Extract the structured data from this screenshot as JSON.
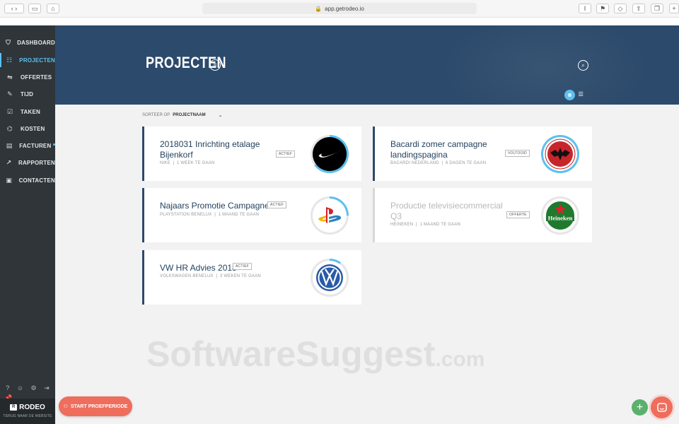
{
  "browser": {
    "url": "app.getrodeo.io",
    "buttons": [
      "‹",
      "›",
      "▭",
      "⌂"
    ]
  },
  "sidebar": {
    "items": [
      {
        "label": "DASHBOARD",
        "icon": "dashboard-icon"
      },
      {
        "label": "PROJECTEN",
        "icon": "projects-icon",
        "active": true
      },
      {
        "label": "OFFERTES",
        "icon": "quotes-icon"
      },
      {
        "label": "TIJD",
        "icon": "time-icon"
      },
      {
        "label": "TAKEN",
        "icon": "tasks-icon"
      },
      {
        "label": "KOSTEN",
        "icon": "costs-icon"
      },
      {
        "label": "FACTUREN",
        "icon": "invoices-icon",
        "dot": true
      },
      {
        "label": "RAPPORTEN",
        "icon": "reports-icon"
      },
      {
        "label": "CONTACTEN",
        "icon": "contacts-icon"
      }
    ],
    "brand": "RODEO",
    "brand_sub": "TERUG NAAR DE WEBSITE"
  },
  "header": {
    "title": "PROJECTEN"
  },
  "sort": {
    "label": "SORTEER OP",
    "value": "PROJECTNAAM"
  },
  "projects": [
    {
      "title": "2018031 Inrichting etalage Bijenkorf",
      "client": "NIKE",
      "time": "1 WEEK TE GAAN",
      "status": "ACTIEF",
      "logo": "nike-logo"
    },
    {
      "title": "Bacardi zomer campagne landingspagina",
      "client": "BACARDI NEDERLAND",
      "time": "6 DAGEN TE GAAN",
      "status": "VOLTOOID",
      "logo": "bacardi-logo"
    },
    {
      "title": "Najaars Promotie Campagne",
      "client": "PLAYSTATION BENELUX",
      "time": "1 MAAND TE GAAN",
      "status": "ACTIEF",
      "logo": "playstation-logo"
    },
    {
      "title": "Productie televisiecommercial Q3",
      "client": "HEINEKEN",
      "time": "1 MAAND TE GAAN",
      "status": "OFFERTE",
      "logo": "heineken-logo"
    },
    {
      "title": "VW HR Advies 2018",
      "client": "VOLKSWAGEN BENELUX",
      "time": "3 WEKEN TE GAAN",
      "status": "ACTIEF",
      "logo": "volkswagen-logo"
    }
  ],
  "brand_labels": {
    "heineken": "Heineken"
  },
  "watermark": {
    "main": "SoftwareSuggest",
    "suffix": ".com"
  },
  "cta": {
    "start_trial": "START PROEFPERIODE"
  },
  "colors": {
    "accent": "#5cc0ef",
    "header": "#2c4a6b",
    "sidebar": "#2f3539",
    "cta": "#ef6d5c",
    "add": "#5cb06d"
  }
}
